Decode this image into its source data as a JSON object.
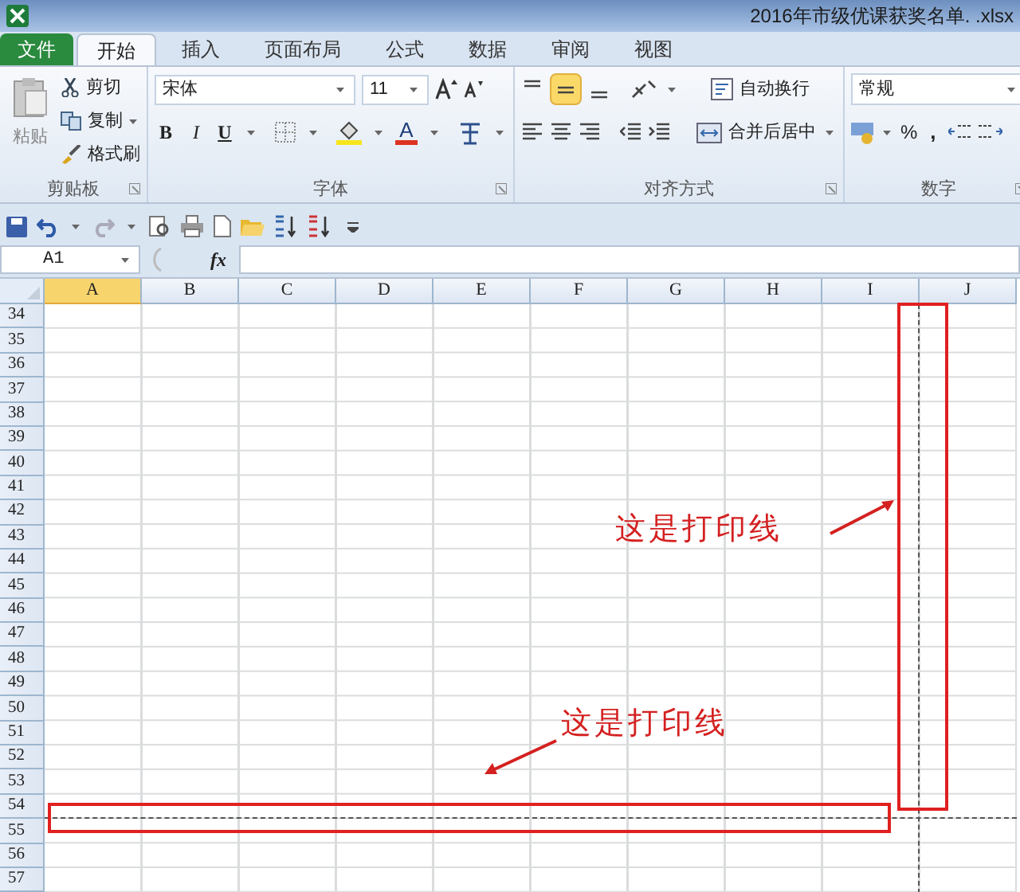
{
  "window": {
    "title": "2016年市级优课获奖名单. .xlsx"
  },
  "file_tab": "文件",
  "tabs": [
    {
      "label": "开始",
      "selected": true
    },
    {
      "label": "插入",
      "selected": false
    },
    {
      "label": "页面布局",
      "selected": false
    },
    {
      "label": "公式",
      "selected": false
    },
    {
      "label": "数据",
      "selected": false
    },
    {
      "label": "审阅",
      "selected": false
    },
    {
      "label": "视图",
      "selected": false
    }
  ],
  "clipboard": {
    "paste": "粘贴",
    "cut": "剪切",
    "copy": "复制",
    "format_painter": "格式刷",
    "label": "剪贴板"
  },
  "font": {
    "name": "宋体",
    "size": "11",
    "bold": "B",
    "italic": "I",
    "underline": "U",
    "font_color": "A",
    "label": "字体"
  },
  "alignment": {
    "middle_align_selected": true,
    "wrap_text": "自动换行",
    "merge_center": "合并后居中",
    "label": "对齐方式"
  },
  "number": {
    "format": "常规",
    "percent": "%",
    "comma": ",",
    "label": "数字"
  },
  "name_box": "A1",
  "fx": "fx",
  "columns": [
    {
      "label": "A",
      "selected": true,
      "page_break": false
    },
    {
      "label": "B",
      "selected": false,
      "page_break": false
    },
    {
      "label": "C",
      "selected": false,
      "page_break": false
    },
    {
      "label": "D",
      "selected": false,
      "page_break": false
    },
    {
      "label": "E",
      "selected": false,
      "page_break": false
    },
    {
      "label": "F",
      "selected": false,
      "page_break": false
    },
    {
      "label": "G",
      "selected": false,
      "page_break": false
    },
    {
      "label": "H",
      "selected": false,
      "page_break": false
    },
    {
      "label": "I",
      "selected": false,
      "page_break": true
    },
    {
      "label": "J",
      "selected": false,
      "page_break": false
    }
  ],
  "rows": [
    {
      "label": "34",
      "page_break": false
    },
    {
      "label": "35",
      "page_break": false
    },
    {
      "label": "36",
      "page_break": false
    },
    {
      "label": "37",
      "page_break": false
    },
    {
      "label": "38",
      "page_break": false
    },
    {
      "label": "39",
      "page_break": false
    },
    {
      "label": "40",
      "page_break": false
    },
    {
      "label": "41",
      "page_break": false
    },
    {
      "label": "42",
      "page_break": false
    },
    {
      "label": "43",
      "page_break": false
    },
    {
      "label": "44",
      "page_break": false
    },
    {
      "label": "45",
      "page_break": false
    },
    {
      "label": "46",
      "page_break": false
    },
    {
      "label": "47",
      "page_break": false
    },
    {
      "label": "48",
      "page_break": false
    },
    {
      "label": "49",
      "page_break": false
    },
    {
      "label": "50",
      "page_break": false
    },
    {
      "label": "51",
      "page_break": false
    },
    {
      "label": "52",
      "page_break": false
    },
    {
      "label": "53",
      "page_break": false
    },
    {
      "label": "54",
      "page_break": true
    },
    {
      "label": "55",
      "page_break": false
    },
    {
      "label": "56",
      "page_break": false
    },
    {
      "label": "57",
      "page_break": false
    }
  ],
  "annotations": [
    {
      "text": "这是打印线"
    },
    {
      "text": "这是打印线"
    }
  ]
}
